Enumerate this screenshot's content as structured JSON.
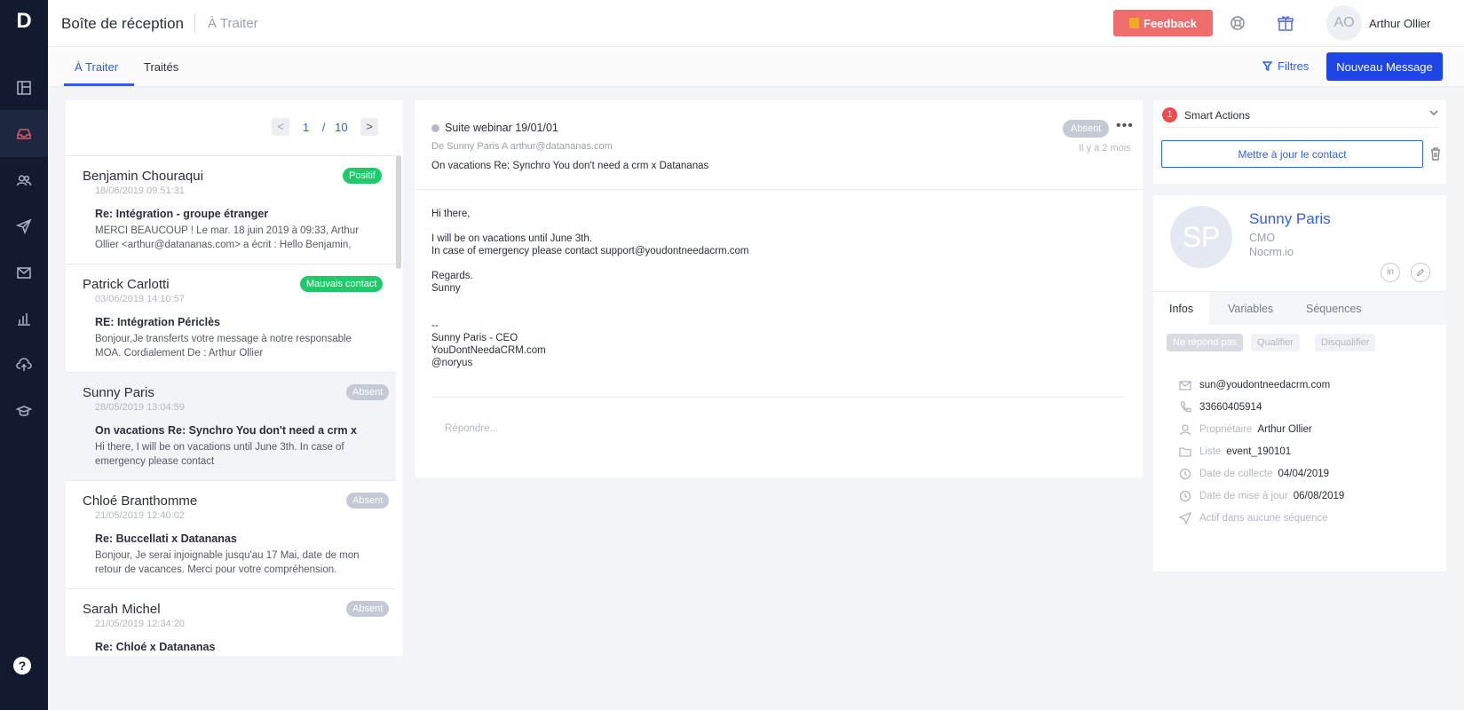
{
  "sidebar": {
    "logo": "D",
    "items": [
      {
        "icon": "layout-icon"
      },
      {
        "icon": "inbox-icon",
        "active": true
      },
      {
        "icon": "contacts-icon"
      },
      {
        "icon": "send-icon"
      },
      {
        "icon": "mail-icon"
      },
      {
        "icon": "chart-icon"
      },
      {
        "icon": "cloud-upload-icon"
      },
      {
        "icon": "school-icon"
      }
    ],
    "help_label": "?"
  },
  "header": {
    "title": "Boîte de réception",
    "subtitle": "À Traiter",
    "feedback_label": "Feedback",
    "user_initials": "AO",
    "user_name": "Arthur Ollier"
  },
  "tabs": {
    "items": [
      "À Traiter",
      "Traités"
    ],
    "active_index": 0,
    "filters_label": "Filtres",
    "new_message_label": "Nouveau Message"
  },
  "pagination": {
    "prev": "<",
    "next": ">",
    "current": "1",
    "separator": "/",
    "total": "10"
  },
  "messages": [
    {
      "name": "Benjamin Chouraqui",
      "date": "18/06/2019 09:51:31",
      "badge": "Positif",
      "badge_style": "green",
      "subject": "Re: Intégration - groupe étranger",
      "preview": "MERCI BEAUCOUP ! Le mar. 18 juin 2019 à 09:33, Arthur Ollier <arthur@datananas.com> a écrit : Hello Benjamin,"
    },
    {
      "name": "Patrick Carlotti",
      "date": "03/06/2019 14:10:57",
      "badge": "Mauvais contact",
      "badge_style": "green",
      "subject": "RE: Intégration Périclès",
      "preview": "Bonjour,Je transferts votre message à notre responsable MOA. Cordialement De : Arthur Ollier"
    },
    {
      "name": "Sunny Paris",
      "date": "28/05/2019 13:04:59",
      "badge": "Absent",
      "badge_style": "grey",
      "subject": "On vacations Re: Synchro You don't need a crm x",
      "preview": "Hi there, I will be on vacations until June 3th. In case of emergency please contact"
    },
    {
      "name": "Chloé Branthomme",
      "date": "21/05/2019 12:40:02",
      "badge": "Absent",
      "badge_style": "grey",
      "subject": "Re: Buccellati x Datananas",
      "preview": "Bonjour, Je serai injoignable jusqu'au 17 Mai, date de mon retour de vacances. Merci pour votre compréhension."
    },
    {
      "name": "Sarah Michel",
      "date": "21/05/2019 12:34:20",
      "badge": "Absent",
      "badge_style": "grey",
      "subject": "Re: Chloé x Datananas",
      "preview": ""
    }
  ],
  "email": {
    "thread_title": "Suite webinar 19/01/01",
    "from_line": "De Sunny Paris A arthur@datananas.com",
    "subject_line": "On vacations Re: Synchro You don't need a crm x Datananas",
    "status_badge": "Absent",
    "more_label": "•••",
    "time_ago": "Il y a 2 mois",
    "body_lines": [
      "Hi there,",
      "I will be on vacations until June 3th.",
      "In case of emergency please contact support@youdontneedacrm.com",
      "Regards.",
      "Sunny",
      "--",
      "Sunny Paris - CEO",
      "YouDontNeedaCRM.com",
      "@noryus"
    ],
    "reply_placeholder": "Répondre..."
  },
  "smart_actions": {
    "count": "1",
    "title": "Smart Actions",
    "button_label": "Mettre à jour le contact"
  },
  "contact": {
    "initials": "SP",
    "name": "Sunny Paris",
    "role": "CMO",
    "company": "Nocrm.io",
    "linkedin_label": "in",
    "tabs": [
      "Infos",
      "Variables",
      "Séquences"
    ],
    "chips": [
      "Ne répond pas",
      "Qualifier",
      "Disqualifier"
    ],
    "info": {
      "email": "sun@youdontneedacrm.com",
      "phone": "33660405914",
      "owner_label": "Propriétaire",
      "owner": "Arthur Ollier",
      "list_label": "Liste",
      "list": "event_190101",
      "collect_label": "Date de collecte",
      "collect_date": "04/04/2019",
      "update_label": "Date de mise à jour",
      "update_date": "06/08/2019",
      "sequence_status": "Actif dans aucune séquence"
    }
  },
  "colors": {
    "sidebar_bg": "#121a30",
    "accent_blue": "#2045e6",
    "link_blue": "#3361e0",
    "feedback_red": "#f06d6d",
    "positive_green": "#1fca6b",
    "absent_grey": "#c5c9d3",
    "sidebar_active_icon": "#e2546b"
  }
}
